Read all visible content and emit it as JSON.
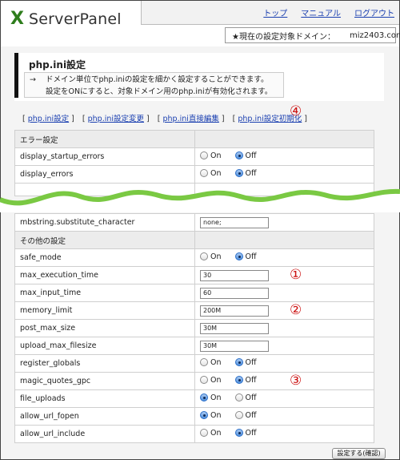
{
  "header": {
    "logo_mark": "X",
    "logo_text": "ServerPanel",
    "nav": [
      "トップ",
      "マニュアル",
      "ログアウト"
    ],
    "domain_label": "★現在の設定対象ドメイン：",
    "domain_value": "miz2403.com"
  },
  "page": {
    "title": "php.ini設定",
    "desc_arrow": "→",
    "desc_line1": "ドメイン単位でphp.iniの設定を細かく設定することができます。",
    "desc_line2": "設定をONにすると、対象ドメイン用のphp.iniが有効化されます。"
  },
  "sublinks": [
    "php.ini設定",
    "php.ini設定変更",
    "php.ini直接編集",
    "php.ini設定初期化"
  ],
  "markers": {
    "m1": "①",
    "m2": "②",
    "m3": "③",
    "m4": "④"
  },
  "radio": {
    "on": "On",
    "off": "Off"
  },
  "table_top": {
    "section": "エラー設定",
    "rows": [
      {
        "name": "display_startup_errors",
        "value": "Off"
      },
      {
        "name": "display_errors",
        "value": "Off"
      }
    ]
  },
  "table_bottom": {
    "first_row": {
      "name": "mbstring.substitute_character",
      "value": "none;"
    },
    "section": "その他の設定",
    "rows": [
      {
        "name": "safe_mode",
        "value": "Off"
      },
      {
        "name": "max_execution_time",
        "input": "30"
      },
      {
        "name": "max_input_time",
        "input": "60"
      },
      {
        "name": "memory_limit",
        "input": "200M"
      },
      {
        "name": "post_max_size",
        "input": "30M"
      },
      {
        "name": "upload_max_filesize",
        "input": "30M"
      },
      {
        "name": "register_globals",
        "value": "Off"
      },
      {
        "name": "magic_quotes_gpc",
        "value": "Off"
      },
      {
        "name": "file_uploads",
        "value": "On"
      },
      {
        "name": "allow_url_fopen",
        "value": "On"
      },
      {
        "name": "allow_url_include",
        "value": "Off"
      }
    ]
  },
  "submit_label": "設定する(確認)",
  "colors": {
    "accent_green": "#7ac943",
    "link": "#1a3fb0",
    "marker_red": "#cc1111"
  }
}
